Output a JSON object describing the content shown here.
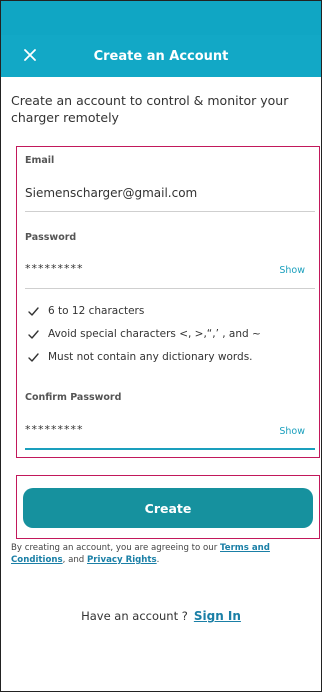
{
  "header": {
    "title": "Create an Account",
    "close_icon": "close-icon"
  },
  "intro_text": "Create an account to control & monitor your charger remotely",
  "form": {
    "email": {
      "label": "Email",
      "value": "Siemenscharger@gmail.com"
    },
    "password": {
      "label": "Password",
      "value": "*********",
      "show_label": "Show"
    },
    "requirements": [
      "6 to 12 characters",
      "Avoid special characters <, >,“,’ , and ~",
      "Must not contain any dictionary words."
    ],
    "confirm_password": {
      "label": "Confirm Password",
      "value": "*********",
      "show_label": "Show"
    }
  },
  "create_button": {
    "label": "Create"
  },
  "terms": {
    "prefix": "By creating an account,  you are agreeing to our ",
    "terms_link": "Terms and Conditions",
    "middle": ", and ",
    "privacy_link": "Privacy Rights",
    "suffix": "."
  },
  "signin": {
    "prompt": "Have an account ?",
    "link": "Sign In"
  },
  "colors": {
    "accent": "#12a8c6",
    "button": "#16919e",
    "link": "#1a7fa6",
    "highlight_border": "#c2185b"
  }
}
